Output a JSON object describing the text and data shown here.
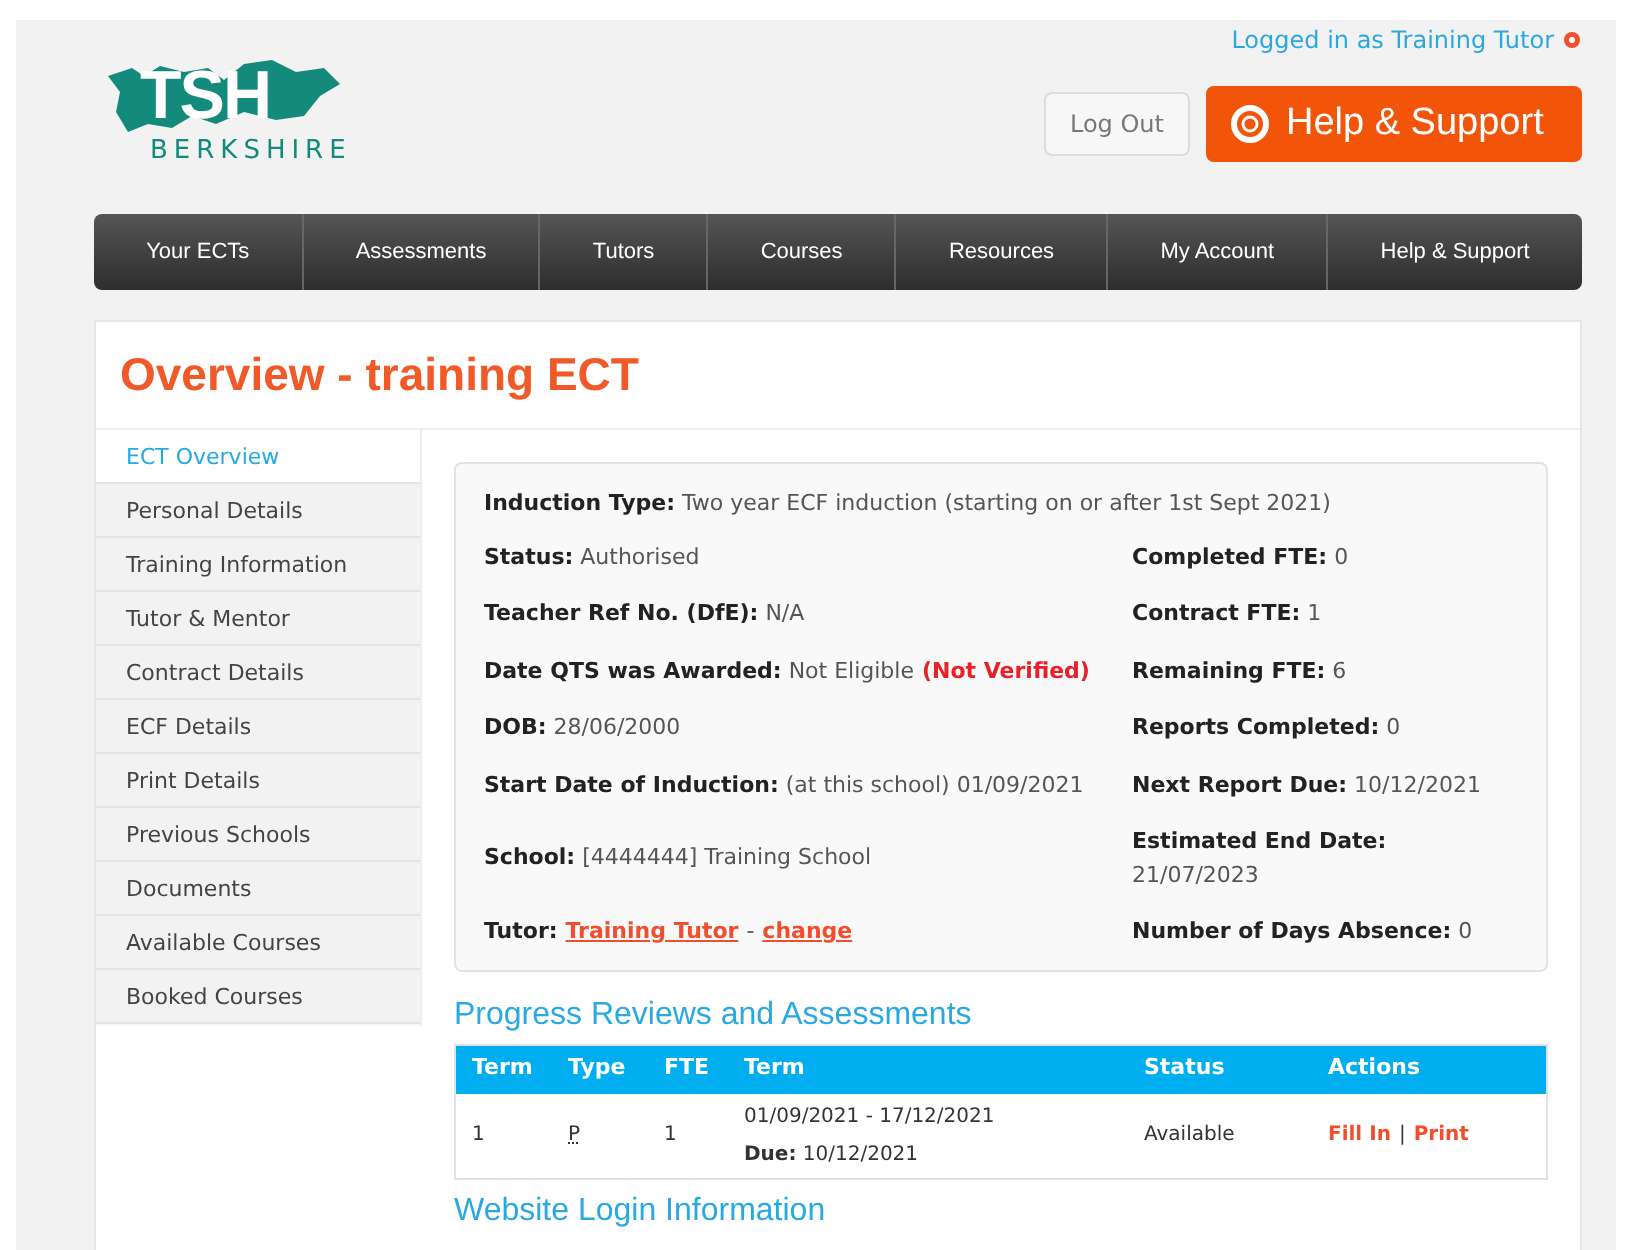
{
  "header": {
    "logo_text": "TSH",
    "logo_subtitle": "BERKSHIRE",
    "logged_in": "Logged in as Training Tutor",
    "logout": "Log Out",
    "help": "Help & Support"
  },
  "nav": [
    {
      "label": "Your ECTs"
    },
    {
      "label": "Assessments"
    },
    {
      "label": "Tutors"
    },
    {
      "label": "Courses"
    },
    {
      "label": "Resources"
    },
    {
      "label": "My Account"
    },
    {
      "label": "Help & Support"
    }
  ],
  "title": "Overview - training ECT",
  "sidebar": {
    "items": [
      {
        "label": "ECT Overview",
        "selected": true
      },
      {
        "label": "Personal Details",
        "selected": false
      },
      {
        "label": "Training Information",
        "selected": false
      },
      {
        "label": "Tutor & Mentor",
        "selected": false
      },
      {
        "label": "Contract Details",
        "selected": false
      },
      {
        "label": "ECF Details",
        "selected": false
      },
      {
        "label": "Print Details",
        "selected": false
      },
      {
        "label": "Previous Schools",
        "selected": false
      },
      {
        "label": "Documents",
        "selected": false
      },
      {
        "label": "Available Courses",
        "selected": false
      },
      {
        "label": "Booked Courses",
        "selected": false
      }
    ]
  },
  "induction": {
    "label": "Induction Type:",
    "value": "Two year ECF induction (starting on or after 1st Sept 2021)"
  },
  "details": [
    {
      "left": {
        "kind": "text",
        "label": "Status:",
        "value": "Authorised"
      },
      "right": {
        "kind": "text",
        "label": "Completed FTE:",
        "value": "0"
      }
    },
    {
      "left": {
        "kind": "text",
        "label": "Teacher Ref No. (DfE):",
        "value": "N/A"
      },
      "right": {
        "kind": "text",
        "label": "Contract FTE:",
        "value": "1"
      }
    },
    {
      "left": {
        "kind": "flagged",
        "label": "Date QTS was Awarded:",
        "value": "Not Eligible",
        "flag": "(Not Verified)"
      },
      "right": {
        "kind": "text",
        "label": "Remaining FTE:",
        "value": "6"
      }
    },
    {
      "left": {
        "kind": "text",
        "label": "DOB:",
        "value": "28/06/2000"
      },
      "right": {
        "kind": "text",
        "label": "Reports Completed:",
        "value": "0"
      }
    },
    {
      "left": {
        "kind": "text",
        "label": "Start Date of Induction:",
        "value": "(at this school) 01/09/2021"
      },
      "right": {
        "kind": "text",
        "label": "Next Report Due:",
        "value": "10/12/2021"
      }
    },
    {
      "left": {
        "kind": "text",
        "label": "School:",
        "value": "[4444444] Training School"
      },
      "right": {
        "kind": "stacked",
        "label": "Estimated End Date:",
        "value": "21/07/2023"
      }
    },
    {
      "left": {
        "kind": "links",
        "label": "Tutor:",
        "links": [
          "Training Tutor",
          "change"
        ],
        "separator": "-"
      },
      "right": {
        "kind": "text",
        "label": "Number of Days Absence:",
        "value": "0"
      }
    }
  ],
  "progress": {
    "heading": "Progress Reviews and Assessments",
    "columns": [
      "Term",
      "Type",
      "FTE",
      "Term",
      "Status",
      "Actions"
    ],
    "rows": [
      {
        "term": "1",
        "type": "P",
        "fte": "1",
        "dates": "01/09/2021 - 17/12/2021",
        "due_label": "Due:",
        "due": "10/12/2021",
        "status": "Available",
        "actions": [
          "Fill In",
          "Print"
        ],
        "separator": "|"
      }
    ]
  },
  "login_heading": "Website Login Information"
}
